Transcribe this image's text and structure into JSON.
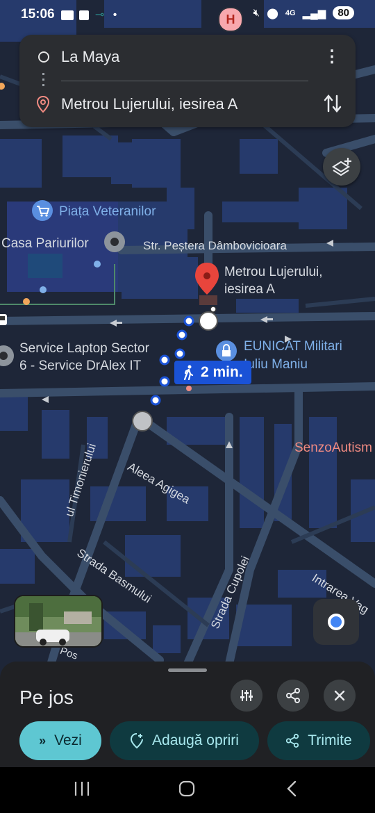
{
  "status_bar": {
    "time": "15:06",
    "battery": "80",
    "network": "4G",
    "left_icons": [
      "gallery-icon",
      "square-icon",
      "key-icon",
      "dot"
    ],
    "h_badge": "H"
  },
  "route_card": {
    "origin": "La Maya",
    "destination": "Metrou Lujerului, iesirea A"
  },
  "map": {
    "labels": {
      "piata": "Piața Veteranilor",
      "casa": "Casa Pariurilor",
      "strada_pestera": "Str. Peștera Dâmbovicioara",
      "destination_line1": "Metrou Lujerului,",
      "destination_line2": "iesirea A",
      "service_line1": "Service Laptop Sector",
      "service_line2": "6 - Service DrAlex IT",
      "eunicat_line1": "EUNICAT Militari",
      "eunicat_line2": "Iuliu Maniu",
      "senzo": "SenzoAutism",
      "aleea": "Aleea Agigea",
      "timonierului": "ul Timonierului",
      "basmului": "Strada Basmului",
      "cupolei": "Strada Cupolei",
      "intrarea": "Intrarea Vag",
      "pos_fragment": "Pos"
    },
    "walk_time": "2 min."
  },
  "sheet": {
    "title": "Pe jos",
    "buttons": {
      "start": "Vezi",
      "add_stops": "Adaugă opriri",
      "share": "Trimite"
    }
  },
  "colors": {
    "map_bg": "#1d2535",
    "block": "#24386a",
    "road": "#3a4e6a",
    "accent_cyan": "#5ec7d2",
    "route_blue": "#1a52d6",
    "pin_red": "#e8453c"
  }
}
